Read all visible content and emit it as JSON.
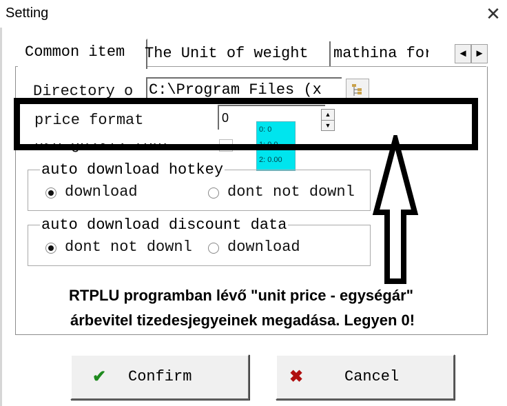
{
  "window": {
    "title": "Setting",
    "close_glyph": "✕"
  },
  "tabs": [
    {
      "label": "Common item",
      "active": true
    },
    {
      "label": "The Unit of weight",
      "active": false
    },
    {
      "label": "mathina format",
      "active": false
    }
  ],
  "tab_scroll": {
    "left": "◄",
    "right": "►"
  },
  "fields": {
    "directory_label": "Directory o",
    "directory_value": "C:\\Program Files (x",
    "price_format_label": "price format",
    "price_format_value": "0",
    "gb2312_label": "use gb2312 font"
  },
  "tooltip_options": [
    "0: 0",
    "1: 0.0",
    "2: 0.00"
  ],
  "groups": {
    "hotkey": {
      "title": "auto download hotkey",
      "options": [
        "download",
        "dont not downl"
      ],
      "selected": 0
    },
    "discount": {
      "title": "auto download discount data",
      "options": [
        "dont not downl",
        "download"
      ],
      "selected": 0
    }
  },
  "annotation": {
    "line1": "RTPLU programban lévő \"unit price - egységár\"",
    "line2": "árbevitel tizedesjegyeinek megadása. Legyen 0!"
  },
  "buttons": {
    "confirm": "Confirm",
    "cancel": "Cancel"
  },
  "icons": {
    "check": "check-icon",
    "cross": "cross-icon",
    "browse": "folder-tree-icon"
  },
  "colors": {
    "tooltip_bg": "#00e5ee",
    "check": "#1e8a1e",
    "cross": "#b01010"
  }
}
